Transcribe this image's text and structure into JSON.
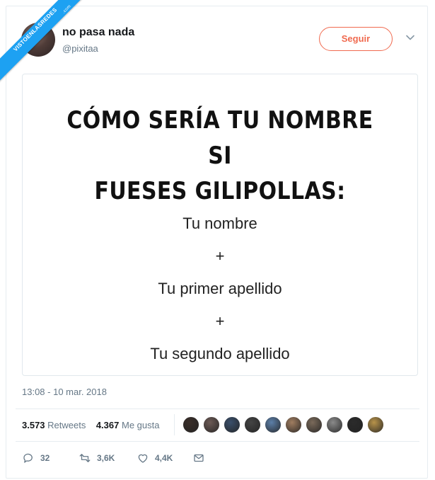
{
  "watermark": {
    "text": "VISTOENLASREDES",
    "suffix": ".com"
  },
  "author": {
    "display_name": "no pasa nada",
    "handle": "@pixitaa"
  },
  "follow_button": {
    "label": "Seguir",
    "color": "#f06a4f"
  },
  "card": {
    "title_line1": "CÓMO SERÍA TU NOMBRE SI",
    "title_line2": "FUESES GILIPOLLAS:",
    "line1": "Tu nombre",
    "plus1": "+",
    "line2": "Tu primer apellido",
    "plus2": "+",
    "line3": "Tu segundo apellido"
  },
  "timestamp": "13:08 - 10 mar. 2018",
  "stats": {
    "retweets_count": "3.573",
    "retweets_label": "Retweets",
    "likes_count": "4.367",
    "likes_label": "Me gusta"
  },
  "likers": [
    {
      "color": "#3b2f2a"
    },
    {
      "color": "#6c5a55"
    },
    {
      "color": "#3a4f6b"
    },
    {
      "color": "#444444"
    },
    {
      "color": "#5c7fa8"
    },
    {
      "color": "#a07d60"
    },
    {
      "color": "#7a6a5a"
    },
    {
      "color": "#8a8a8a"
    },
    {
      "color": "#2b2b2b"
    },
    {
      "color": "#b8934a"
    }
  ],
  "actions": {
    "reply_count": "32",
    "retweet_count": "3,6K",
    "like_count": "4,4K"
  },
  "colors": {
    "accent": "#1da1f2",
    "muted": "#657786"
  }
}
